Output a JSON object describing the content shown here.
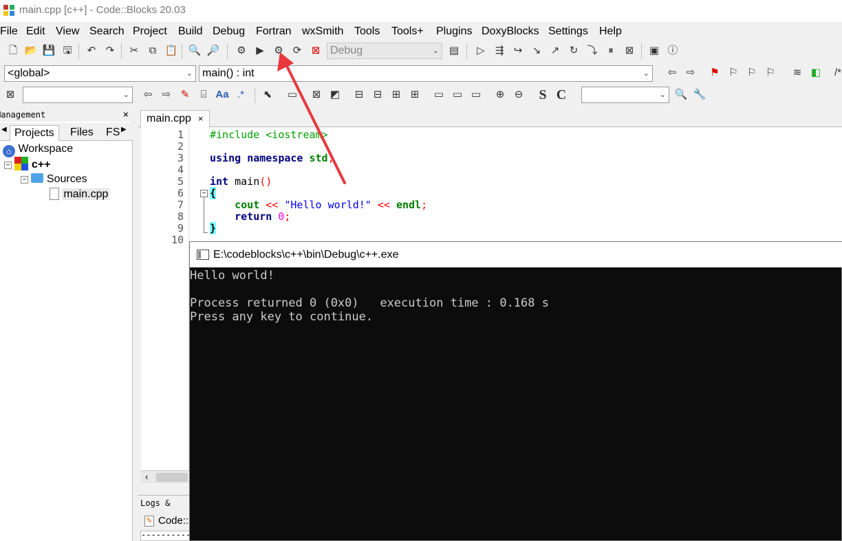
{
  "window": {
    "title": "main.cpp [c++] - Code::Blocks 20.03"
  },
  "menu": [
    "File",
    "Edit",
    "View",
    "Search",
    "Project",
    "Build",
    "Debug",
    "Fortran",
    "wxSmith",
    "Tools",
    "Tools+",
    "Plugins",
    "DoxyBlocks",
    "Settings",
    "Help"
  ],
  "toolbar1": {
    "build_target": "Debug"
  },
  "toolbar2": {
    "scope": "<global>",
    "function": "main() : int",
    "comment_hint": "/*"
  },
  "toolbar3": {
    "search_value": "",
    "right_combo_value": "",
    "s_label": "S",
    "c_label": "C",
    "aa_label": "Aa",
    "regex_label": ".*"
  },
  "management": {
    "title": "Management",
    "close": "×",
    "tabs": [
      "Projects",
      "Files",
      "FS"
    ],
    "tree": {
      "workspace": "Workspace",
      "project": "c++",
      "folder": "Sources",
      "file": "main.cpp"
    }
  },
  "editor": {
    "tab_label": "main.cpp",
    "tab_close": "×",
    "line_numbers": [
      "1",
      "2",
      "3",
      "4",
      "5",
      "6",
      "7",
      "8",
      "9",
      "10"
    ],
    "lines": {
      "l1": "#include <iostream>",
      "l3_kw1": "using",
      "l3_kw2": "namespace",
      "l3_id": "std",
      "l3_semi": ";",
      "l5_kw": "int",
      "l5_fn": "main",
      "l5_paren": "()",
      "l6": "{",
      "l7_fn": "cout",
      "l7_op1": "<<",
      "l7_str": "\"Hello world!\"",
      "l7_op2": "<<",
      "l7_endl": "endl",
      "l7_semi": ";",
      "l8_kw": "return",
      "l8_num": "0",
      "l8_semi": ";",
      "l9": "}"
    }
  },
  "logs": {
    "title": "Logs & others",
    "tab_label": "Code::Blocks",
    "body": "------------"
  },
  "console": {
    "title": "E:\\codeblocks\\c++\\bin\\Debug\\c++.exe",
    "lines": [
      "Hello world!",
      "",
      "Process returned 0 (0x0)   execution time : 0.168 s",
      "Press any key to continue."
    ]
  },
  "colors": {
    "arrow": "#e8383d",
    "console_bg": "#0c0c0c",
    "console_fg": "#cccccc"
  }
}
